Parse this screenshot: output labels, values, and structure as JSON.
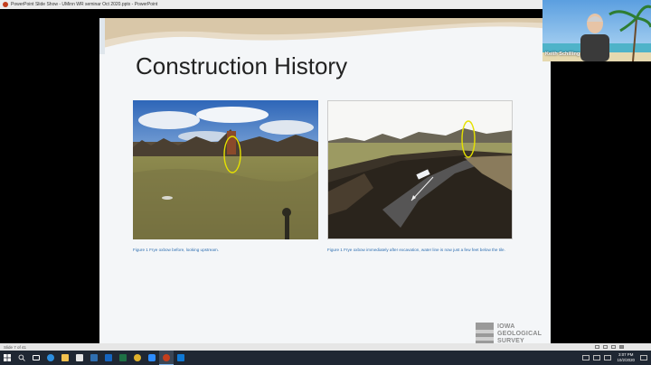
{
  "window": {
    "title": "PowerPoint Slide Show  -  UMinn WR seminar Oct 2020.pptx  -  PowerPoint"
  },
  "slide": {
    "title": "Construction History",
    "caption_left": "Figure 1 Frye oxbow before, looking upstream.",
    "caption_right": "Figure 1 Frye oxbow immediately after excavation, water line is now just a few feet below the tile.",
    "logo": {
      "line1": "IOWA",
      "line2": "GEOLOGICAL",
      "line3": "SURVEY"
    }
  },
  "video": {
    "participant_name": "Keith Schilling"
  },
  "status": {
    "slide_indicator": "Slide 7 of 41"
  },
  "taskbar": {
    "time": "3:07 PM",
    "date": "10/2/2020"
  },
  "colors": {
    "caption": "#2f6fb1",
    "annotation_circle": "#e5e100",
    "taskbar": "#1f2733"
  }
}
